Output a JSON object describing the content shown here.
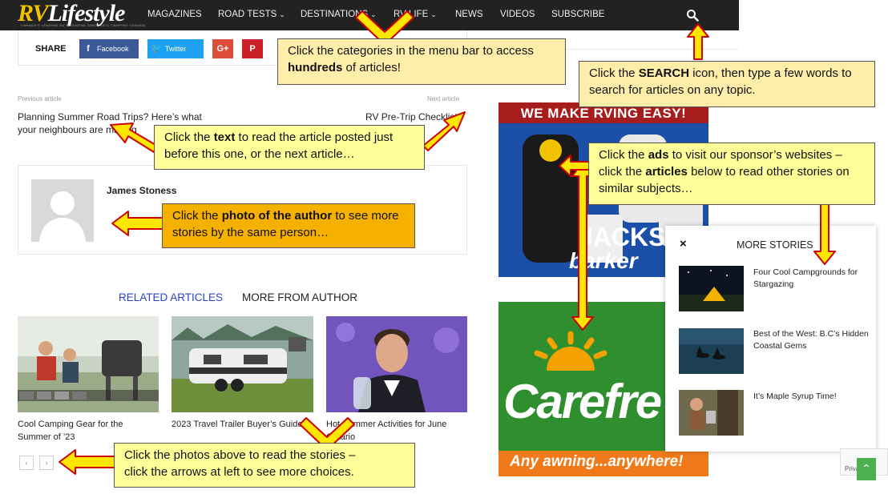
{
  "nav": {
    "logo_rv": "RV",
    "logo_lifestyle": "Lifestyle",
    "logo_sub": "CANADA'S LEADING RV MAGAZINE SINCE 1971",
    "logo_sub_right": "CAMPING CANADA",
    "items": [
      {
        "label": "MAGAZINES",
        "dropdown": false
      },
      {
        "label": "ROAD TESTS",
        "dropdown": true
      },
      {
        "label": "DESTINATIONS",
        "dropdown": true
      },
      {
        "label": "RV LIFE",
        "dropdown": true
      },
      {
        "label": "NEWS",
        "dropdown": false
      },
      {
        "label": "VIDEOS",
        "dropdown": false
      },
      {
        "label": "SUBSCRIBE",
        "dropdown": false
      }
    ],
    "search_icon": "search-icon"
  },
  "share": {
    "label": "SHARE",
    "facebook": "Facebook",
    "twitter": "Twitter",
    "googleplus_icon": "G+",
    "pinterest_icon": "P"
  },
  "article_nav": {
    "prev_label": "Previous article",
    "next_label": "Next article",
    "prev_title_line1": "Planning Summer Road Trips? Here’s what",
    "prev_title_line2": "your neighbours are making",
    "next_title": "RV Pre-Trip Checklist"
  },
  "author": {
    "name": "James Stoness"
  },
  "tabs": {
    "related": "RELATED ARTICLES",
    "more_from_author": "MORE FROM AUTHOR"
  },
  "related": [
    {
      "line1": "Cool Camping Gear for the",
      "line2": "Summer of ’23"
    },
    {
      "line1": "2023 Travel Trailer Buyer’s Guide",
      "line2": ""
    },
    {
      "line1": "Hot Summer Activities for June",
      "line2": "Ontario"
    }
  ],
  "pager": {
    "prev": "‹",
    "next": "›"
  },
  "ads": {
    "ad1_headline": "WE MAKE RVING EASY!",
    "ad1_brand": "barker",
    "ad1_product": "JACKS",
    "ad2_brand": "Carefre",
    "ad2_tagline": "Any awning...anywhere!"
  },
  "more_stories": {
    "title": "MORE STORIES",
    "close": "×",
    "items": [
      {
        "title": "Four Cool Campgrounds for Stargazing"
      },
      {
        "title": "Best of the West: B.C’s Hidden Coastal Gems"
      },
      {
        "title": "It’s Maple Syrup Time!"
      }
    ]
  },
  "recaptcha": {
    "text": "Priva"
  },
  "callouts": {
    "menu": {
      "pre": "Click the categories in the menu bar to access ",
      "bold": "hundreds",
      "post": " of articles!"
    },
    "search": {
      "pre": "Click the ",
      "bold": "SEARCH",
      "post": " icon, then type a few words to search for articles on any topic."
    },
    "text": {
      "pre": "Click the ",
      "bold": "text",
      "post": " to read the article posted just before this one, or the next article…"
    },
    "ads": {
      "pre": "Click the ",
      "bold1": "ads",
      "mid": " to visit our sponsor’s websites – click the ",
      "bold2": "articles",
      "post": " below to read other stories on similar subjects…"
    },
    "author": {
      "pre": "Click the ",
      "bold": "photo of the author",
      "post": " to see more stories by the same person…"
    },
    "photos": {
      "line1": "Click the photos above to read the stories –",
      "line2": "click the arrows at left to see more choices."
    }
  },
  "colors": {
    "nav_bg": "#222222",
    "logo_yellow": "#f2c200",
    "facebook": "#3b5998",
    "twitter": "#1da1f2",
    "googleplus": "#dd4b39",
    "pinterest": "#cb2027",
    "tab_active": "#2a44b8",
    "callout_yellow": "#ffff99",
    "callout_orange": "#f5b000",
    "arrow_fill": "#ffe600",
    "arrow_stroke": "#d00000"
  }
}
